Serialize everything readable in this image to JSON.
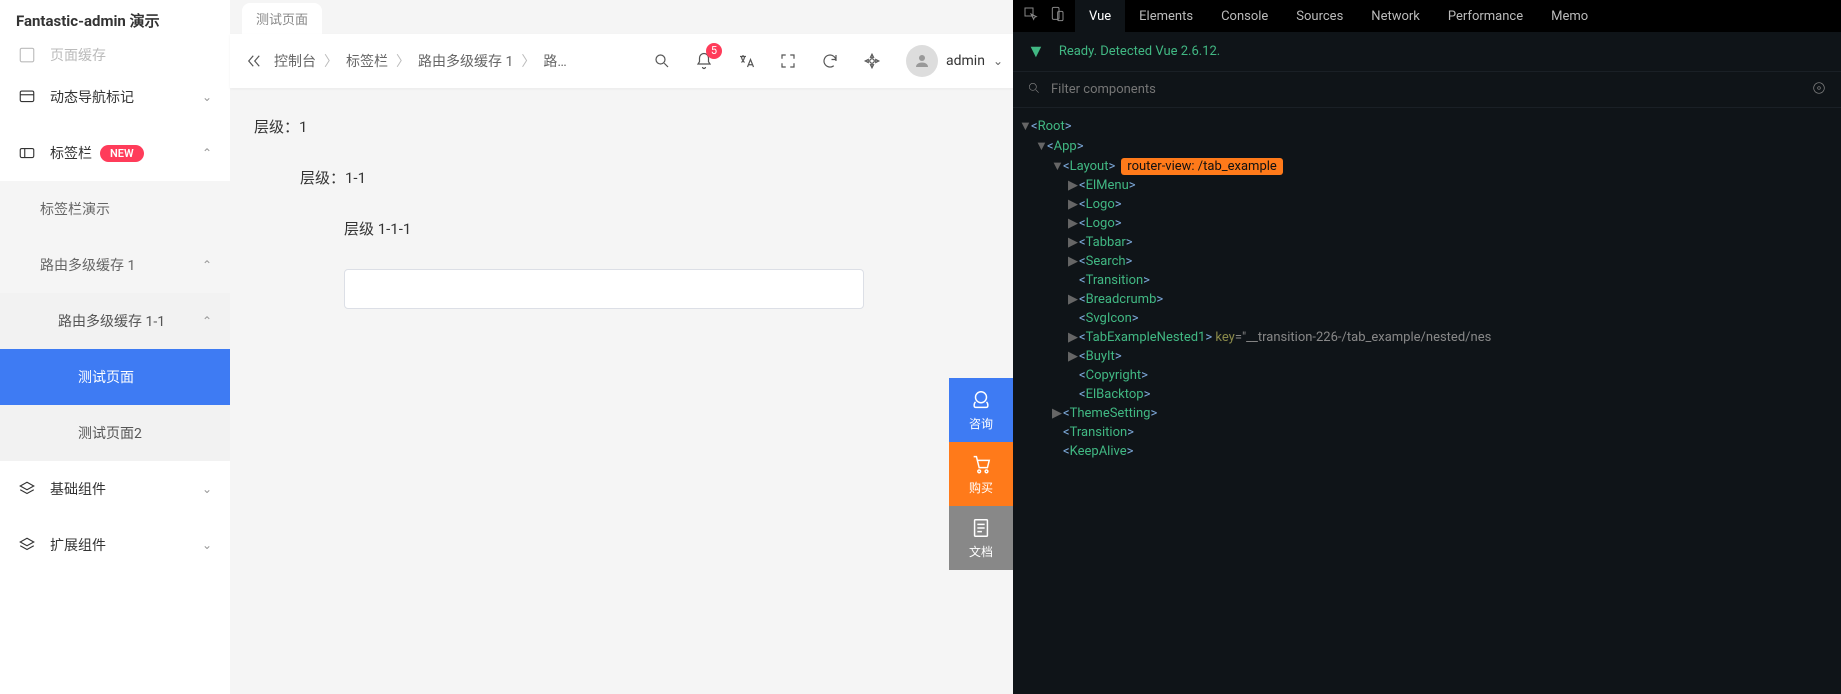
{
  "app": {
    "title": "Fantastic-admin 演示",
    "sidebar": {
      "truncated_top": "页面缓存",
      "items": [
        {
          "label": "动态导航标记",
          "icon": "bookmark-icon",
          "chev": "⌄"
        },
        {
          "label": "标签栏",
          "icon": "tab-icon",
          "badge": "NEW",
          "chev": "⌃"
        }
      ],
      "sub": [
        {
          "label": "标签栏演示",
          "level": 1
        },
        {
          "label": "路由多级缓存 1",
          "level": 1,
          "chev": "⌃"
        },
        {
          "label": "路由多级缓存 1-1",
          "level": 2,
          "chev": "⌃"
        },
        {
          "label": "测试页面",
          "level": 3,
          "active": true
        },
        {
          "label": "测试页面2",
          "level": 3
        }
      ],
      "after": [
        {
          "label": "基础组件",
          "icon": "layers-icon",
          "chev": "⌄"
        },
        {
          "label": "扩展组件",
          "icon": "layers-icon",
          "chev": "⌄"
        }
      ]
    },
    "tab": {
      "label": "测试页面"
    },
    "breadcrumb": [
      "控制台",
      "标签栏",
      "路由多级缓存 1",
      "路…"
    ],
    "notif_count": "5",
    "user": {
      "name": "admin"
    },
    "levels": {
      "l1": "层级：1",
      "l2": "层级：1-1",
      "l3": "层级 1-1-1"
    },
    "input_value": "",
    "float": {
      "consult": "咨询",
      "buy": "购买",
      "docs": "文档"
    }
  },
  "devtools": {
    "tabs": [
      "Vue",
      "Elements",
      "Console",
      "Sources",
      "Network",
      "Performance",
      "Memo"
    ],
    "active_tab": "Vue",
    "status": "Ready. Detected Vue 2.6.12.",
    "filter_placeholder": "Filter components",
    "tree": [
      {
        "indent": 0,
        "tw": "▼",
        "name": "Root"
      },
      {
        "indent": 1,
        "tw": "▼",
        "name": "App"
      },
      {
        "indent": 2,
        "tw": "▼",
        "name": "Layout",
        "highlight": "router-view: /tab_example"
      },
      {
        "indent": 3,
        "tw": "▶",
        "name": "ElMenu"
      },
      {
        "indent": 3,
        "tw": "▶",
        "name": "Logo"
      },
      {
        "indent": 3,
        "tw": "▶",
        "name": "Logo"
      },
      {
        "indent": 3,
        "tw": "▶",
        "name": "Tabbar"
      },
      {
        "indent": 3,
        "tw": "▶",
        "name": "Search"
      },
      {
        "indent": 3,
        "tw": "",
        "name": "Transition"
      },
      {
        "indent": 3,
        "tw": "▶",
        "name": "Breadcrumb"
      },
      {
        "indent": 3,
        "tw": "",
        "name": "SvgIcon"
      },
      {
        "indent": 3,
        "tw": "▶",
        "name": "TabExampleNested1",
        "attr_key": "key",
        "attr_val": "\"__transition-226-/tab_example/nested/nes"
      },
      {
        "indent": 3,
        "tw": "▶",
        "name": "BuyIt"
      },
      {
        "indent": 3,
        "tw": "",
        "name": "Copyright"
      },
      {
        "indent": 3,
        "tw": "",
        "name": "ElBacktop"
      },
      {
        "indent": 2,
        "tw": "▶",
        "name": "ThemeSetting"
      },
      {
        "indent": 2,
        "tw": "",
        "name": "Transition"
      },
      {
        "indent": 2,
        "tw": "",
        "name": "KeepAlive"
      }
    ]
  }
}
